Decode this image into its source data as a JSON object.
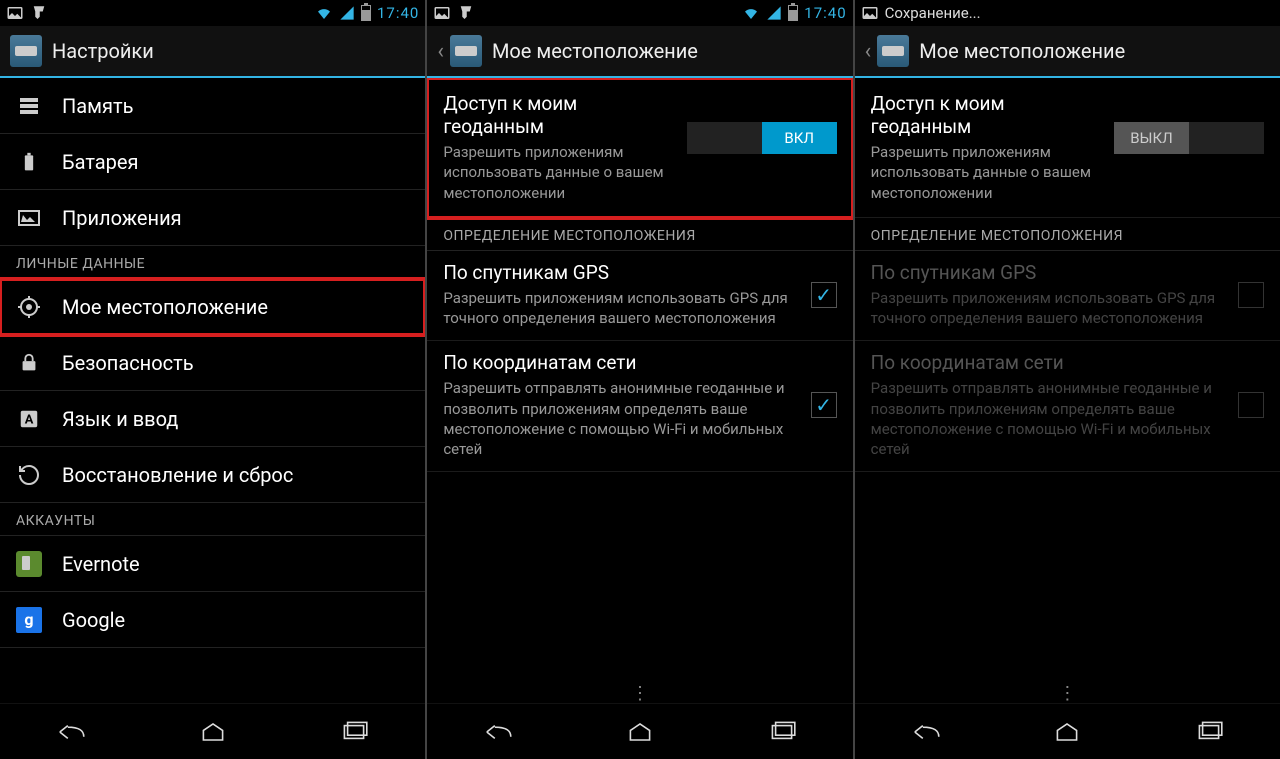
{
  "clock": "17:40",
  "saving_label": "Сохранение...",
  "screen1": {
    "title": "Настройки",
    "items": [
      {
        "label": "Память",
        "icon": "storage"
      },
      {
        "label": "Батарея",
        "icon": "battery"
      },
      {
        "label": "Приложения",
        "icon": "apps"
      }
    ],
    "section_personal": "ЛИЧНЫЕ ДАННЫЕ",
    "personal": [
      {
        "label": "Мое местоположение",
        "icon": "location",
        "highlight": true
      },
      {
        "label": "Безопасность",
        "icon": "lock"
      },
      {
        "label": "Язык и ввод",
        "icon": "lang"
      },
      {
        "label": "Восстановление и сброс",
        "icon": "restore"
      }
    ],
    "section_accounts": "АККАУНТЫ",
    "accounts": [
      {
        "label": "Evernote",
        "icon": "evernote"
      },
      {
        "label": "Google",
        "icon": "google"
      }
    ]
  },
  "screen2": {
    "title": "Мое местоположение",
    "access": {
      "title": "Доступ к моим геоданным",
      "sub": "Разрешить приложениям использовать данные о вашем местоположении",
      "toggle_on": "ВКЛ"
    },
    "section": "ОПРЕДЕЛЕНИЕ МЕСТОПОЛОЖЕНИЯ",
    "gps": {
      "title": "По спутникам GPS",
      "sub": "Разрешить приложениям использовать GPS для точного определения вашего местоположения"
    },
    "net": {
      "title": "По координатам сети",
      "sub": "Разрешить отправлять анонимные геоданные и позволить приложениям определять ваше местоположение с помощью Wi-Fi и мобильных сетей"
    }
  },
  "screen3": {
    "title": "Мое местоположение",
    "access": {
      "title": "Доступ к моим геоданным",
      "sub": "Разрешить приложениям использовать данные о вашем местоположении",
      "toggle_off": "ВЫКЛ"
    },
    "section": "ОПРЕДЕЛЕНИЕ МЕСТОПОЛОЖЕНИЯ",
    "gps": {
      "title": "По спутникам GPS",
      "sub": "Разрешить приложениям использовать GPS для точного определения вашего местоположения"
    },
    "net": {
      "title": "По координатам сети",
      "sub": "Разрешить отправлять анонимные геоданные и позволить приложениям определять ваше местоположение с помощью Wi-Fi и мобильных сетей"
    }
  }
}
